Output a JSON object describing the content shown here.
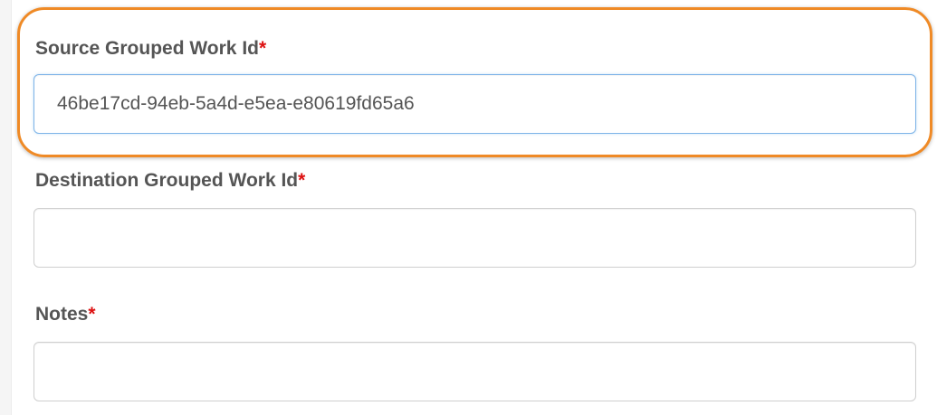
{
  "form": {
    "source": {
      "label": "Source Grouped Work Id",
      "required_marker": "*",
      "value": "46be17cd-94eb-5a4d-e5ea-e80619fd65a6"
    },
    "destination": {
      "label": "Destination Grouped Work Id",
      "required_marker": "*",
      "value": ""
    },
    "notes": {
      "label": "Notes",
      "required_marker": "*",
      "value": ""
    }
  },
  "colors": {
    "highlight_ring": "#ef8a26",
    "required_marker": "#dd1111",
    "focus_border": "#7eb4e8"
  }
}
